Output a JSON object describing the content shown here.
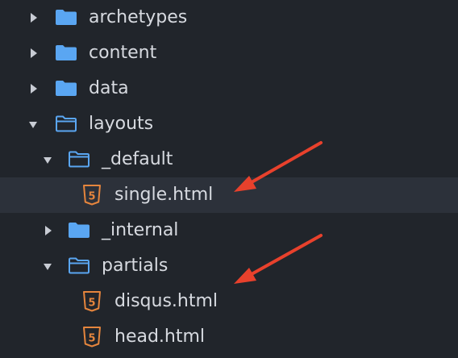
{
  "tree": {
    "items": [
      {
        "label": "archetypes",
        "icon": "folder-closed-icon",
        "state": "collapsed"
      },
      {
        "label": "content",
        "icon": "folder-closed-icon",
        "state": "collapsed"
      },
      {
        "label": "data",
        "icon": "folder-closed-icon",
        "state": "collapsed"
      },
      {
        "label": "layouts",
        "icon": "folder-open-icon",
        "state": "expanded"
      },
      {
        "label": "_default",
        "icon": "folder-open-icon",
        "state": "expanded"
      },
      {
        "label": "single.html",
        "icon": "html5-icon",
        "state": "file",
        "selected": true
      },
      {
        "label": "_internal",
        "icon": "folder-closed-icon",
        "state": "collapsed"
      },
      {
        "label": "partials",
        "icon": "folder-open-icon",
        "state": "expanded"
      },
      {
        "label": "disqus.html",
        "icon": "html5-icon",
        "state": "file"
      },
      {
        "label": "head.html",
        "icon": "html5-icon",
        "state": "file"
      }
    ]
  },
  "colors": {
    "background": "#21252b",
    "selected_row": "#2c313a",
    "text": "#d7dae0",
    "folder": "#5aa6f2",
    "html_icon": "#e5853d",
    "annotation_arrow": "#e8412c"
  }
}
